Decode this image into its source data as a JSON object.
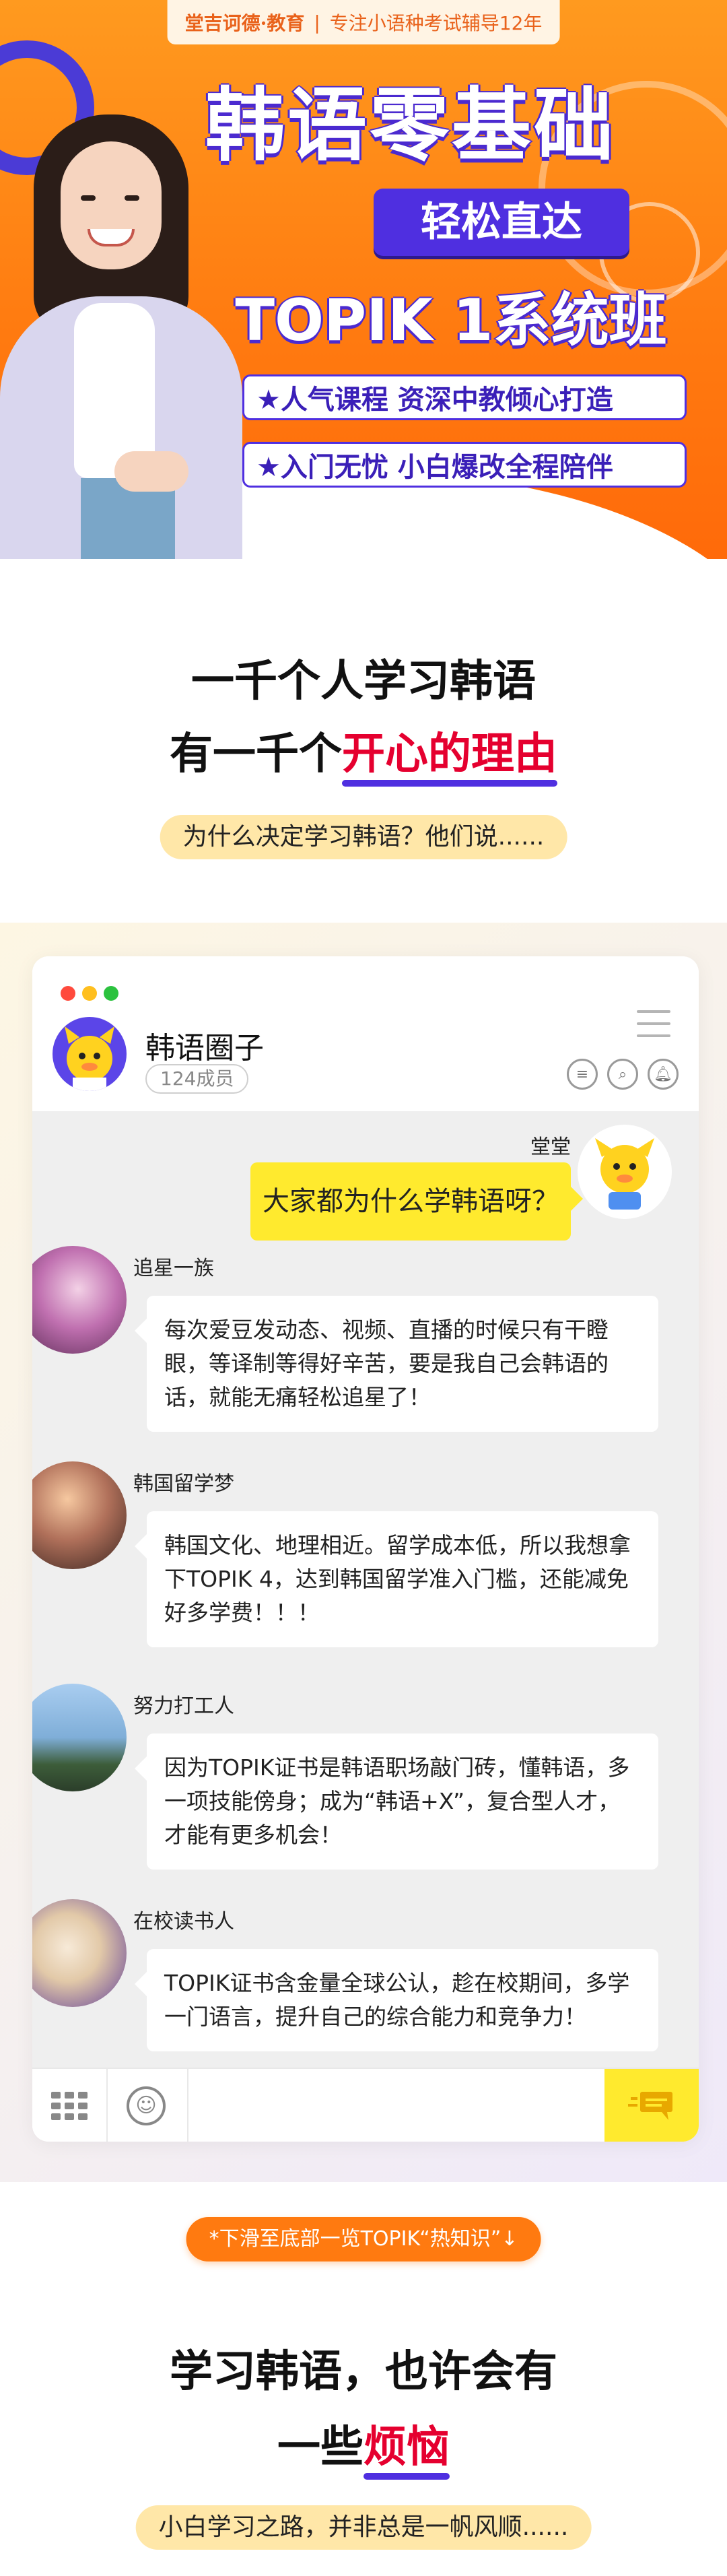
{
  "brand": {
    "logo": "堂吉诃德·教育",
    "separator": "|",
    "slogan": "专注小语种考试辅导12年"
  },
  "hero": {
    "title1": "韩语零基础",
    "pill": "轻松直达",
    "title2": "TOPIK 1系统班",
    "features": [
      "★人气课程 资深中教倾心打造",
      "★入门无忧 小白爆改全程陪伴"
    ]
  },
  "section1": {
    "line1": "一千个人学习韩语",
    "line2_prefix": "有一千个",
    "line2_highlight": "开心的理由",
    "subtitle": "为什么决定学习韩语？他们说......"
  },
  "chat": {
    "group_name": "韩语圈子",
    "member_count": "124成员",
    "my_name": "堂堂",
    "my_message": "大家都为什么学韩语呀？",
    "messages": [
      {
        "name": "追星一族",
        "text": "每次爱豆发动态、视频、直播的时候只有干瞪眼，等译制等得好辛苦，要是我自己会韩语的话，就能无痛轻松追星了！"
      },
      {
        "name": "韩国留学梦",
        "text": "韩国文化、地理相近。留学成本低，所以我想拿下TOPIK 4，达到韩国留学准入门槛，还能减免好多学费！！！"
      },
      {
        "name": "努力打工人",
        "text": "因为TOPIK证书是韩语职场敲门砖，懂韩语，多一项技能傍身；成为“韩语+X”，复合型人才，才能有更多机会！"
      },
      {
        "name": "在校读书人",
        "text": "TOPIK证书含金量全球公认，趁在校期间，多学一门语言，提升自己的综合能力和竞争力！"
      }
    ]
  },
  "tip": "*下滑至底部一览TOPIK“热知识”↓",
  "section2": {
    "line1": "学习韩语，也许会有",
    "line2_prefix": "一些",
    "line2_highlight": "烦恼",
    "subtitle": "小白学习之路，并非总是一帆风顺......"
  },
  "colors": {
    "hero_orange": "#ff7a10",
    "brand_purple": "#4f2fe0",
    "highlight_red": "#e5002f",
    "bubble_yellow": "#ffea2e",
    "pill_yellow": "#ffe7a8"
  }
}
